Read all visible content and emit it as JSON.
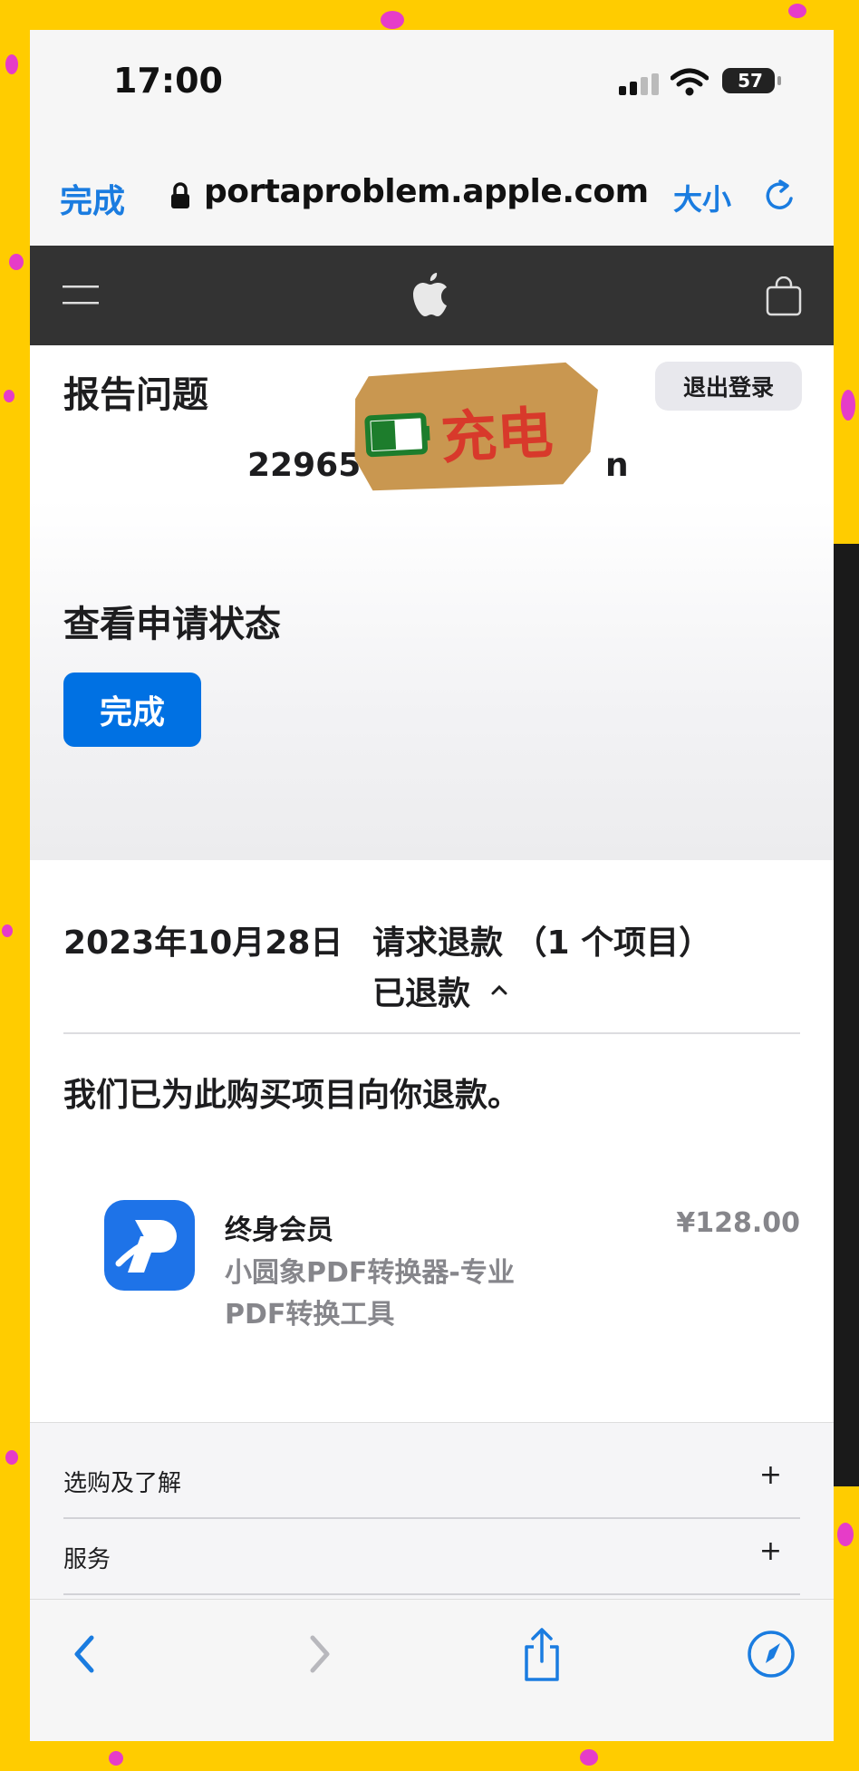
{
  "status_bar": {
    "time": "17:00",
    "battery_level": "57"
  },
  "browser": {
    "done_label": "完成",
    "url": "portaproblem.apple.com",
    "text_size_label": "大小"
  },
  "page": {
    "title": "报告问题",
    "logout_label": "退出登录",
    "account_prefix": "22965",
    "account_suffix": "n",
    "sticker_text": "充电"
  },
  "status_section": {
    "heading": "查看申请状态",
    "button_label": "完成"
  },
  "request": {
    "date": "2023年10月28日",
    "type": "请求退款 （1 个项目）",
    "status": "已退款",
    "message": "我们已为此购买项目向你退款。",
    "item": {
      "name": "终身会员",
      "app_line1": "小圆象PDF转换器-专业",
      "app_line2": "PDF转换工具",
      "price": "¥128.00"
    }
  },
  "footer": {
    "rows": [
      {
        "label": "选购及了解",
        "toggle": "+"
      },
      {
        "label": "服务",
        "toggle": "+"
      }
    ]
  },
  "icons": [
    "signal-icon",
    "wifi-icon",
    "battery-icon",
    "lock-icon",
    "reload-icon",
    "menu-icon",
    "apple-logo-icon",
    "bag-icon",
    "chevron-up-icon",
    "app-icon",
    "back-icon",
    "forward-icon",
    "share-icon",
    "compass-icon"
  ],
  "colors": {
    "frame": "#FFCC00",
    "link_blue": "#1A7CE0",
    "button_blue": "#0071E3",
    "nav_dark": "#333333",
    "app_icon_blue": "#1E73E8"
  }
}
